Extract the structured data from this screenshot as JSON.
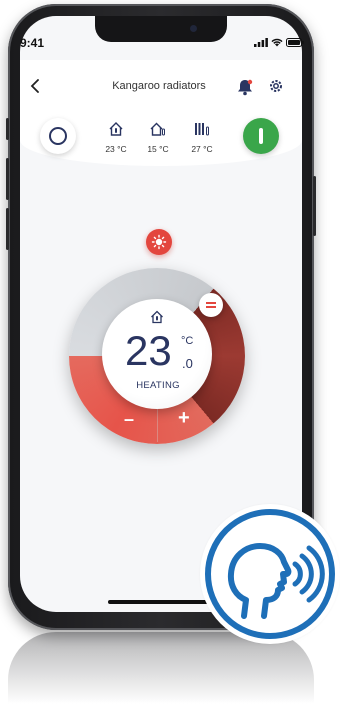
{
  "status_bar": {
    "time": "9:41"
  },
  "header": {
    "title": "Kangaroo radiators"
  },
  "presets": [
    {
      "icon": "home-thermometer-icon",
      "temp": "23 °C"
    },
    {
      "icon": "away-icon",
      "temp": "15 °C"
    },
    {
      "icon": "radiator-icon",
      "temp": "27 °C"
    }
  ],
  "thermostat": {
    "temperature": "23",
    "unit": "°C",
    "decimal": ".0",
    "mode": "HEATING",
    "minus_label": "–",
    "plus_label": "+"
  },
  "colors": {
    "accent_red": "#e3463e",
    "power_green": "#3aa64a",
    "text_navy": "#2a3561",
    "badge_blue": "#1e6fb8"
  }
}
